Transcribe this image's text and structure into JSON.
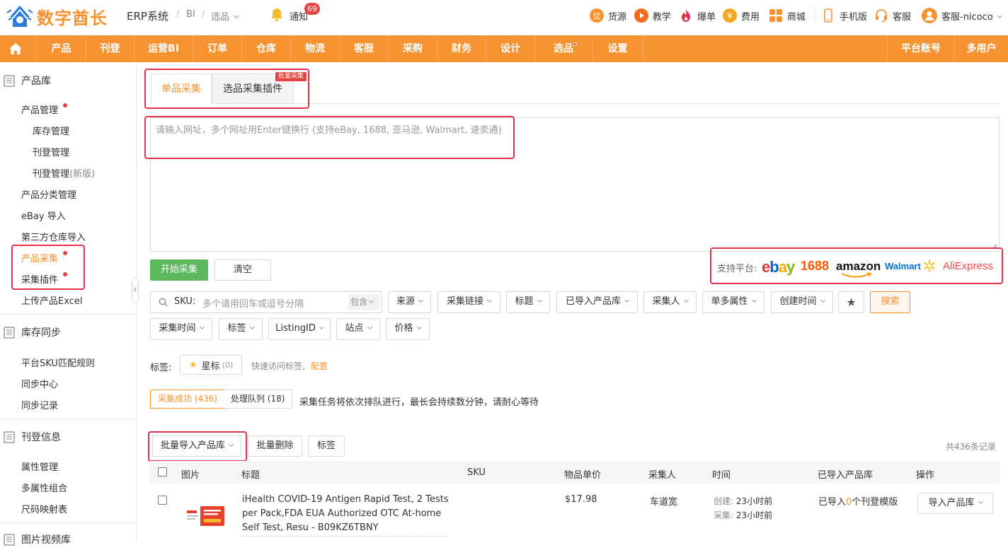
{
  "header": {
    "logo_text": "数字酋长",
    "app_title": "ERP系统",
    "breadcrumb": [
      "BI",
      "选品"
    ],
    "notify_label": "通知",
    "notify_count": "69",
    "links": [
      {
        "label": "货源",
        "icon": "youxuan-badge-icon"
      },
      {
        "label": "教学",
        "icon": "play-circle-icon"
      },
      {
        "label": "爆单",
        "icon": "flame-icon"
      },
      {
        "label": "费用",
        "icon": "yen-coin-icon"
      },
      {
        "label": "商城",
        "icon": "grid-apps-icon"
      },
      {
        "label": "手机版",
        "icon": "phone-icon"
      },
      {
        "label": "客服",
        "icon": "headset-icon"
      },
      {
        "label": "客服-nicoco",
        "icon": "user-avatar-icon"
      }
    ]
  },
  "nav": {
    "items": [
      "产品",
      "刊登",
      "运营BI",
      "订单",
      "仓库",
      "物流",
      "客服",
      "采购",
      "财务",
      "设计",
      "选品",
      "设置"
    ],
    "right_items": [
      "平台账号",
      "多用户"
    ]
  },
  "sidebar": {
    "sections": [
      {
        "title": "产品库",
        "items": [
          "产品管理",
          "库存管理",
          "刊登管理",
          "刊登管理",
          "产品分类管理",
          "eBay 导入",
          "第三方仓库导入",
          "产品采集",
          "采集插件",
          "上传产品Excel"
        ]
      },
      {
        "title": "库存同步",
        "items": [
          "平台SKU匹配规则",
          "同步中心",
          "同步记录"
        ]
      },
      {
        "title": "刊登信息",
        "items": [
          "属性管理",
          "多属性组合",
          "尺码映射表"
        ]
      },
      {
        "title": "图片视频库",
        "items": []
      }
    ],
    "new_suffix": "(新版)"
  },
  "tabs": {
    "single": "单品采集",
    "plugin": "选品采集插件",
    "badge": "批量采集"
  },
  "url_input": {
    "placeholder": "请输入网址，多个网址用Enter键换行 (支持eBay, 1688, 亚马逊, Walmart, 速卖通)"
  },
  "actions": {
    "start": "开始采集",
    "clear": "清空"
  },
  "platforms": {
    "label": "支持平台:",
    "list": [
      "ebay",
      "1688",
      "amazon",
      "Walmart",
      "AliExpress"
    ]
  },
  "filters": {
    "sku_label": "SKU:",
    "sku_placeholder": "多个请用回车或逗号分隔",
    "contains": "包含",
    "row1": [
      "来源",
      "采集链接",
      "标题",
      "已导入产品库",
      "采集人",
      "单多属性",
      "创建时间"
    ],
    "row2": [
      "采集时间",
      "标签",
      "ListingID",
      "站点",
      "价格"
    ],
    "search": "搜索"
  },
  "tags": {
    "label": "标签:",
    "star_label": "星标",
    "star_count": "(0)",
    "hint": "快速访问标签,",
    "config": "配置"
  },
  "status": {
    "success": "采集成功 (436)",
    "queue": "处理队列 (18)",
    "hint": "采集任务将依次排队进行，最长会持续数分钟，请耐心等待"
  },
  "bulk": {
    "import": "批量导入产品库",
    "delete": "批量删除",
    "tag": "标签",
    "total": "共436条记录"
  },
  "table": {
    "headers": [
      "图片",
      "标题",
      "SKU",
      "物品单价",
      "采集人",
      "时间",
      "已导入产品库",
      "操作"
    ],
    "rows": [
      {
        "title": "iHealth COVID-19 Antigen Rapid Test, 2 Tests per Pack,FDA EUA Authorized OTC At-home Self Test, Resu  - B09KZ6TBNY",
        "sku": "",
        "price": "$17.98",
        "collector": "车道宽",
        "created_label": "创建:",
        "created": "23小时前",
        "collected_label": "采集:",
        "collected": "23小时前",
        "imported_prefix": "已导入",
        "imported_count": "0",
        "imported_suffix": "个刊登模版",
        "action": "导入产品库"
      }
    ]
  },
  "colors": {
    "brand": "#f79230",
    "highlight": "#e5304a",
    "primary_green": "#5cb85c",
    "alert_red": "#e64340"
  }
}
